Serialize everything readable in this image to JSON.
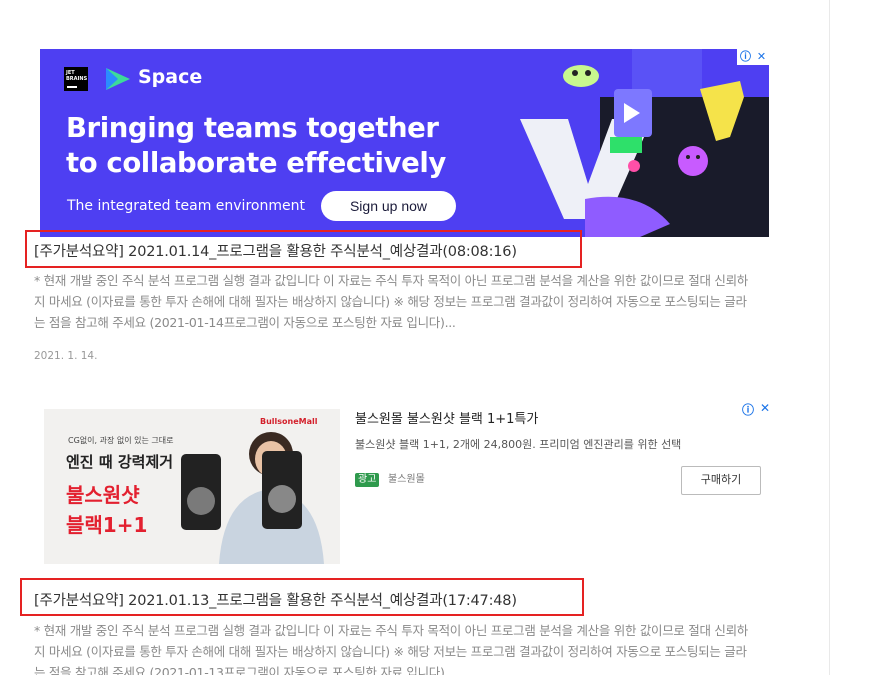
{
  "banner_ad": {
    "brand_logo_text": "JET BRAINS",
    "product_name": "Space",
    "headline_line1": "Bringing teams together",
    "headline_line2": "to collaborate effectively",
    "subline": "The integrated team environment",
    "cta_label": "Sign up now",
    "info_icon": "ⓘ",
    "close_icon": "✕",
    "colors": {
      "background": "#4e3ff2",
      "dark_panel": "#191b2a",
      "accent_yellow": "#f5e34a",
      "accent_green": "#2ee06a",
      "accent_pink": "#ff4fa8"
    }
  },
  "posts": [
    {
      "title": "[주가분석요약] 2021.01.14_프로그램을 활용한 주식분석_예상결과(08:08:16)",
      "excerpt": "* 현재 개발 중인 주식 분석 프로그램 실행 결과 값입니다 이 자료는 주식 투자 목적이 아닌 프로그램 분석을 계산을 위한 값이므로 절대 신뢰하지 마세요 (이자료를 통한 투자 손해에 대해 필자는 배상하지 않습니다) ※ 해당 정보는 프로그램 결과값이 정리하여 자동으로 포스팅되는 글라는 점을 참고해 주세요 (2021-01-14프로그램이 자동으로 포스팅한 자료 입니다)...",
      "date": "2021. 1. 14."
    },
    {
      "title": "[주가분석요약] 2021.01.13_프로그램을 활용한 주식분석_예상결과(17:47:48)",
      "excerpt": "* 현재 개발 중인 주식 분석 프로그램 실행 결과 값입니다 이 자료는 주식 투자 목적이 아닌 프로그램 분석을 계산을 위한 값이므로 절대 신뢰하지 마세요 (이자료를 통한 투자 손해에 대해 필자는 배상하지 않습니다) ※ 해당 저보는 프로그램 결과값이 정리하여 자동으로 포스팅되는 글라는 점을 참고해 주세요 (2021-01-13프로그램이 자동으로 포스팅한 자료 입니다)..."
    }
  ],
  "native_ad": {
    "title": "불스원몰 불스원샷 블랙 1+1특가",
    "description": "불스원샷 블랙 1+1, 2개에 24,800원. 프리미엄 엔진관리를 위한 선택",
    "badge": "광고",
    "advertiser": "불스원몰",
    "cta_label": "구매하기",
    "info_icon": "ⓘ",
    "close_icon": "✕",
    "image": {
      "mall_label": "BullsoneMall",
      "tagline": "CG없이, 과장 없이 있는 그대로",
      "line1": "엔진 때 강력제거",
      "line2": "불스원샷",
      "line3": "블랙1+1"
    }
  }
}
